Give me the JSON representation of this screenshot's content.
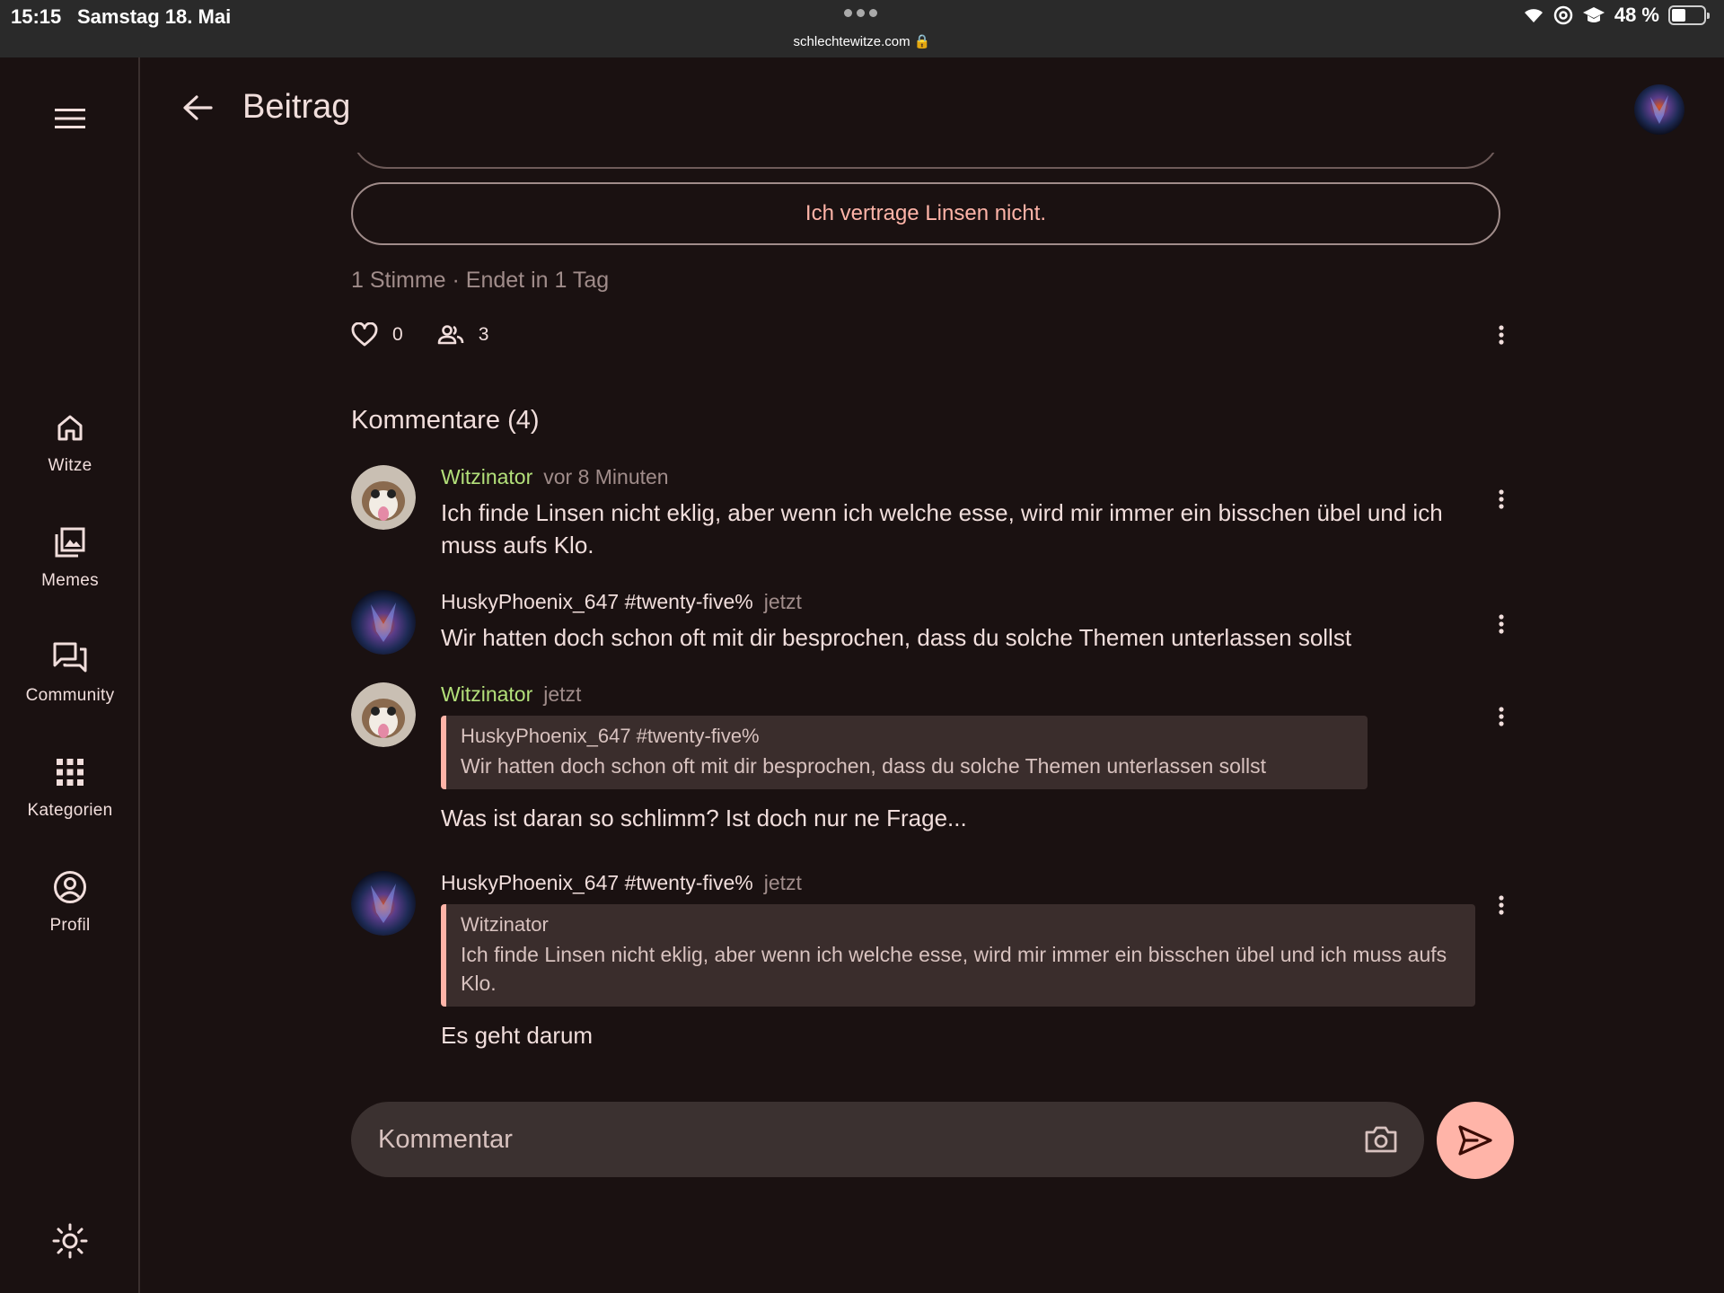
{
  "status_bar": {
    "time": "15:15",
    "date": "Samstag 18. Mai",
    "url": "schlechtewitze.com 🔒",
    "battery": "48 %"
  },
  "nav": {
    "items": [
      {
        "label": "Witze",
        "icon": "home-icon"
      },
      {
        "label": "Memes",
        "icon": "gallery-icon"
      },
      {
        "label": "Community",
        "icon": "forum-icon"
      },
      {
        "label": "Kategorien",
        "icon": "apps-grid-icon"
      },
      {
        "label": "Profil",
        "icon": "account-circle-icon"
      }
    ]
  },
  "header": {
    "title": "Beitrag"
  },
  "poll": {
    "option_label": "Ich vertrage Linsen nicht.",
    "meta": "1 Stimme · Endet in 1 Tag",
    "likes": "0",
    "participants": "3"
  },
  "comments_title": "Kommentare (4)",
  "comments": [
    {
      "author": "Witzinator",
      "time": "vor 8 Minuten",
      "text": "Ich finde Linsen nicht eklig, aber wenn ich welche esse, wird mir immer ein bisschen übel und ich muss aufs Klo."
    },
    {
      "author": "HuskyPhoenix_647 #twenty-five%",
      "time": "jetzt",
      "text": "Wir hatten doch schon oft mit dir besprochen, dass du solche Themen unterlassen sollst"
    },
    {
      "author": "Witzinator",
      "time": "jetzt",
      "quote_author": "HuskyPhoenix_647 #twenty-five%",
      "quote_text": "Wir hatten doch schon oft mit dir besprochen, dass du solche Themen unterlassen sollst",
      "text": "Was ist daran so schlimm? Ist doch nur ne Frage..."
    },
    {
      "author": "HuskyPhoenix_647 #twenty-five%",
      "time": "jetzt",
      "quote_author": "Witzinator",
      "quote_text": "Ich finde Linsen nicht eklig, aber wenn ich welche esse, wird mir immer ein bisschen übel und ich muss aufs Klo.",
      "text": "Es geht darum"
    }
  ],
  "composer": {
    "placeholder": "Kommentar"
  },
  "colors": {
    "background": "#1a1111",
    "accent": "#ffb4a8",
    "author_green": "#b3e07a",
    "muted": "#a08c8a"
  }
}
